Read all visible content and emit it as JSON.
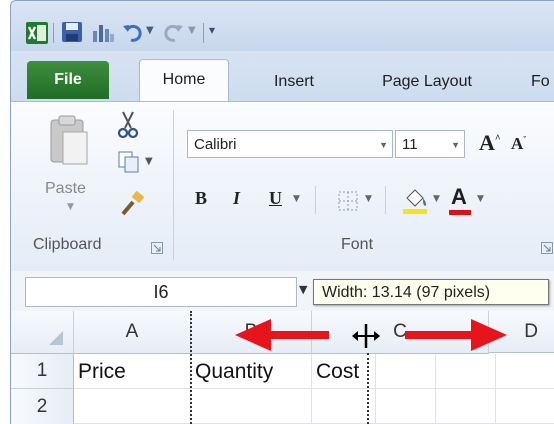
{
  "tabs": {
    "file": "File",
    "home": "Home",
    "insert": "Insert",
    "page_layout": "Page Layout",
    "formulas_partial": "Fo"
  },
  "clipboard": {
    "paste_label": "Paste",
    "group_label": "Clipboard"
  },
  "font": {
    "name": "Calibri",
    "size": "11",
    "bold": "B",
    "italic": "I",
    "underline": "U",
    "grow": "A",
    "shrink": "A",
    "font_color_letter": "A",
    "group_label": "Font"
  },
  "formula_bar": {
    "name_box": "I6",
    "tooltip": "Width: 13.14 (97 pixels)"
  },
  "grid": {
    "columns": [
      "A",
      "B",
      "C",
      "D"
    ],
    "rows": [
      "1",
      "2"
    ],
    "row1": {
      "a": "Price",
      "b": "Quantity",
      "c": "Cost"
    }
  },
  "colors": {
    "file_tab": "#2a7a2f",
    "arrow": "#e8141c",
    "highlight_yellow": "#f7e11b",
    "font_red": "#d8121a"
  }
}
